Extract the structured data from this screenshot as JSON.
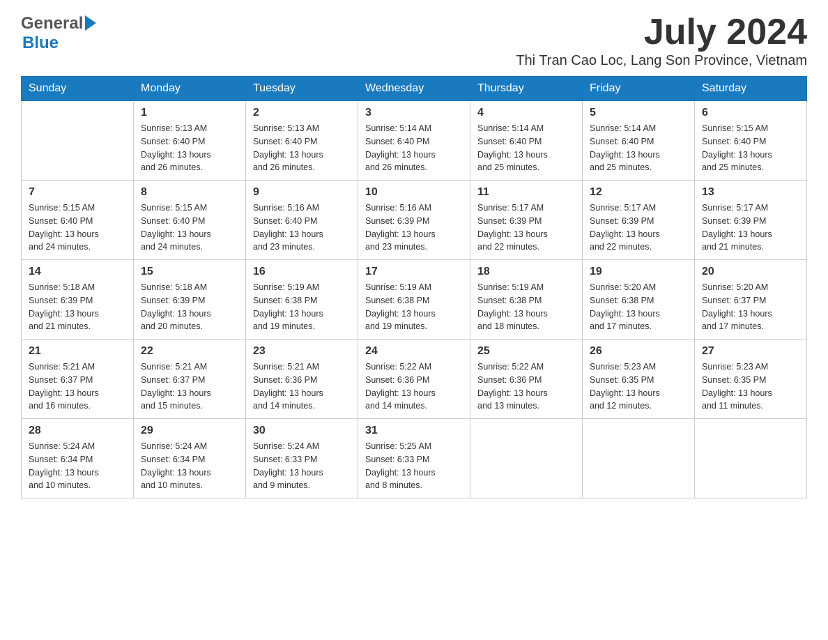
{
  "header": {
    "month_year": "July 2024",
    "location": "Thi Tran Cao Loc, Lang Son Province, Vietnam",
    "logo_general": "General",
    "logo_blue": "Blue"
  },
  "days_of_week": [
    "Sunday",
    "Monday",
    "Tuesday",
    "Wednesday",
    "Thursday",
    "Friday",
    "Saturday"
  ],
  "weeks": [
    {
      "days": [
        {
          "num": "",
          "info": ""
        },
        {
          "num": "1",
          "info": "Sunrise: 5:13 AM\nSunset: 6:40 PM\nDaylight: 13 hours\nand 26 minutes."
        },
        {
          "num": "2",
          "info": "Sunrise: 5:13 AM\nSunset: 6:40 PM\nDaylight: 13 hours\nand 26 minutes."
        },
        {
          "num": "3",
          "info": "Sunrise: 5:14 AM\nSunset: 6:40 PM\nDaylight: 13 hours\nand 26 minutes."
        },
        {
          "num": "4",
          "info": "Sunrise: 5:14 AM\nSunset: 6:40 PM\nDaylight: 13 hours\nand 25 minutes."
        },
        {
          "num": "5",
          "info": "Sunrise: 5:14 AM\nSunset: 6:40 PM\nDaylight: 13 hours\nand 25 minutes."
        },
        {
          "num": "6",
          "info": "Sunrise: 5:15 AM\nSunset: 6:40 PM\nDaylight: 13 hours\nand 25 minutes."
        }
      ]
    },
    {
      "days": [
        {
          "num": "7",
          "info": "Sunrise: 5:15 AM\nSunset: 6:40 PM\nDaylight: 13 hours\nand 24 minutes."
        },
        {
          "num": "8",
          "info": "Sunrise: 5:15 AM\nSunset: 6:40 PM\nDaylight: 13 hours\nand 24 minutes."
        },
        {
          "num": "9",
          "info": "Sunrise: 5:16 AM\nSunset: 6:40 PM\nDaylight: 13 hours\nand 23 minutes."
        },
        {
          "num": "10",
          "info": "Sunrise: 5:16 AM\nSunset: 6:39 PM\nDaylight: 13 hours\nand 23 minutes."
        },
        {
          "num": "11",
          "info": "Sunrise: 5:17 AM\nSunset: 6:39 PM\nDaylight: 13 hours\nand 22 minutes."
        },
        {
          "num": "12",
          "info": "Sunrise: 5:17 AM\nSunset: 6:39 PM\nDaylight: 13 hours\nand 22 minutes."
        },
        {
          "num": "13",
          "info": "Sunrise: 5:17 AM\nSunset: 6:39 PM\nDaylight: 13 hours\nand 21 minutes."
        }
      ]
    },
    {
      "days": [
        {
          "num": "14",
          "info": "Sunrise: 5:18 AM\nSunset: 6:39 PM\nDaylight: 13 hours\nand 21 minutes."
        },
        {
          "num": "15",
          "info": "Sunrise: 5:18 AM\nSunset: 6:39 PM\nDaylight: 13 hours\nand 20 minutes."
        },
        {
          "num": "16",
          "info": "Sunrise: 5:19 AM\nSunset: 6:38 PM\nDaylight: 13 hours\nand 19 minutes."
        },
        {
          "num": "17",
          "info": "Sunrise: 5:19 AM\nSunset: 6:38 PM\nDaylight: 13 hours\nand 19 minutes."
        },
        {
          "num": "18",
          "info": "Sunrise: 5:19 AM\nSunset: 6:38 PM\nDaylight: 13 hours\nand 18 minutes."
        },
        {
          "num": "19",
          "info": "Sunrise: 5:20 AM\nSunset: 6:38 PM\nDaylight: 13 hours\nand 17 minutes."
        },
        {
          "num": "20",
          "info": "Sunrise: 5:20 AM\nSunset: 6:37 PM\nDaylight: 13 hours\nand 17 minutes."
        }
      ]
    },
    {
      "days": [
        {
          "num": "21",
          "info": "Sunrise: 5:21 AM\nSunset: 6:37 PM\nDaylight: 13 hours\nand 16 minutes."
        },
        {
          "num": "22",
          "info": "Sunrise: 5:21 AM\nSunset: 6:37 PM\nDaylight: 13 hours\nand 15 minutes."
        },
        {
          "num": "23",
          "info": "Sunrise: 5:21 AM\nSunset: 6:36 PM\nDaylight: 13 hours\nand 14 minutes."
        },
        {
          "num": "24",
          "info": "Sunrise: 5:22 AM\nSunset: 6:36 PM\nDaylight: 13 hours\nand 14 minutes."
        },
        {
          "num": "25",
          "info": "Sunrise: 5:22 AM\nSunset: 6:36 PM\nDaylight: 13 hours\nand 13 minutes."
        },
        {
          "num": "26",
          "info": "Sunrise: 5:23 AM\nSunset: 6:35 PM\nDaylight: 13 hours\nand 12 minutes."
        },
        {
          "num": "27",
          "info": "Sunrise: 5:23 AM\nSunset: 6:35 PM\nDaylight: 13 hours\nand 11 minutes."
        }
      ]
    },
    {
      "days": [
        {
          "num": "28",
          "info": "Sunrise: 5:24 AM\nSunset: 6:34 PM\nDaylight: 13 hours\nand 10 minutes."
        },
        {
          "num": "29",
          "info": "Sunrise: 5:24 AM\nSunset: 6:34 PM\nDaylight: 13 hours\nand 10 minutes."
        },
        {
          "num": "30",
          "info": "Sunrise: 5:24 AM\nSunset: 6:33 PM\nDaylight: 13 hours\nand 9 minutes."
        },
        {
          "num": "31",
          "info": "Sunrise: 5:25 AM\nSunset: 6:33 PM\nDaylight: 13 hours\nand 8 minutes."
        },
        {
          "num": "",
          "info": ""
        },
        {
          "num": "",
          "info": ""
        },
        {
          "num": "",
          "info": ""
        }
      ]
    }
  ]
}
